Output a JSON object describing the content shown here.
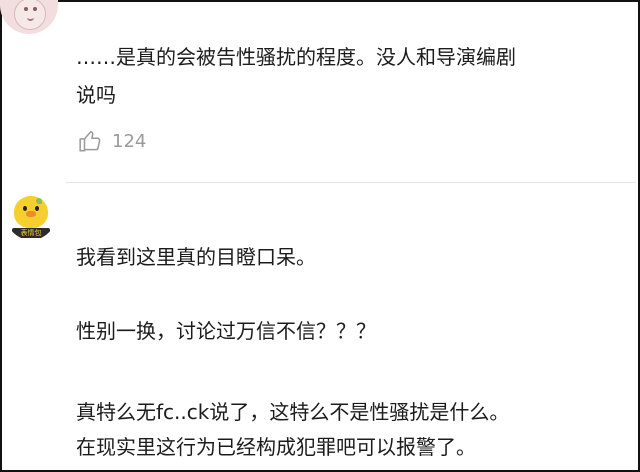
{
  "comment1": {
    "line1": "……是真的会被告性骚扰的程度。没人和导演编剧",
    "line2": "说吗",
    "likes": "124"
  },
  "comment2": {
    "avatar_caption": "表情包",
    "p1": "我看到这里真的目瞪口呆。",
    "p2": "性别一换，讨论过万信不信？？？",
    "p3_line1": "真特么无fc..ck说了，这特么不是性骚扰是什么。",
    "p3_line2": "在现实里这行为已经构成犯罪吧可以报警了。"
  },
  "icons": {
    "like": "thumbs-up-icon"
  },
  "colors": {
    "text": "#1c1c1c",
    "like_count": "#9a9a9a",
    "chick": "#f4cf2e",
    "divider": "#e6e6e6"
  }
}
